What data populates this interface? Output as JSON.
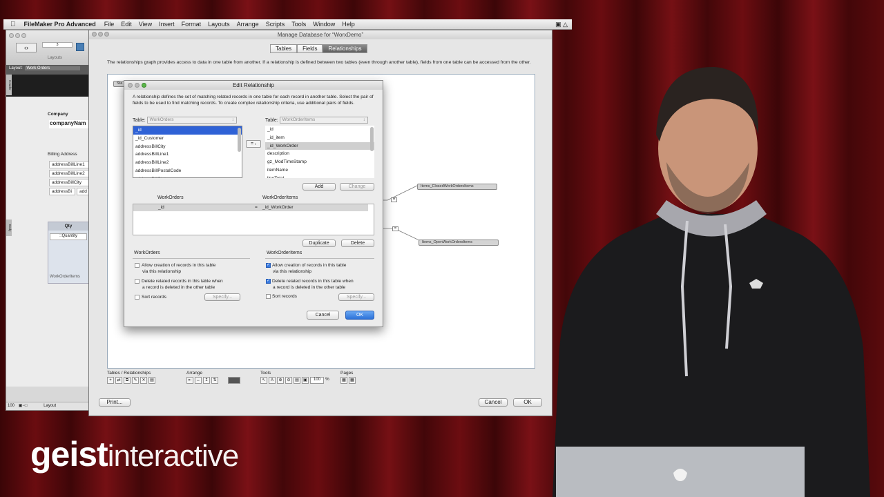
{
  "menubar": {
    "app_name": "FileMaker Pro Advanced",
    "items": [
      "File",
      "Edit",
      "View",
      "Insert",
      "Format",
      "Layouts",
      "Arrange",
      "Scripts",
      "Tools",
      "Window",
      "Help"
    ]
  },
  "fm_window": {
    "record_number": "3",
    "layouts_label": "Layouts",
    "layout_prefix": "Layout:",
    "layout_name": "Work Orders",
    "header_tab": "Header",
    "company_label": "Company",
    "company_field": "companyNam",
    "billing_label": "Billing Address",
    "billing_fields": [
      "addressBillLine1",
      "addressBillLine2",
      "addressBillCity",
      "addressBi"
    ],
    "billing_extra": "add",
    "qty_label": "Qty",
    "qty_field": "::Quantity",
    "portal_label": "WorkOrderItems",
    "body_tab": "Body",
    "zoom": "100",
    "mode": "Layout"
  },
  "manage_db": {
    "title": "Manage Database for “WorxDemo”",
    "tabs": [
      "Tables",
      "Fields",
      "Relationships"
    ],
    "active_tab": "Relationships",
    "description": "The relationships graph provides access to data in one table from another. If a relationship is defined between two tables (even through another table), fields from one table can be accessed from the other.",
    "graph_partial_label": "Sta",
    "occurrences": [
      "Items_ClosedWorkOrdersItems",
      "Items_OpenWorkOrdersItems"
    ],
    "rel_symbol": "=",
    "toolbar_groups": [
      "Tables / Relationships",
      "Arrange",
      "Tools",
      "Pages"
    ],
    "zoom_value": "100",
    "zoom_unit": "%",
    "print_label": "Print...",
    "cancel_label": "Cancel",
    "ok_label": "OK"
  },
  "edit_relationship": {
    "title": "Edit Relationship",
    "description": "A relationship defines the set of matching related records in one table for each record in another table. Select the pair of fields to be used to find matching records. To create complex relationship criteria, use additional pairs of fields.",
    "table_label": "Table:",
    "left_table": "WorkOrders",
    "right_table": "WorkOrderItems",
    "left_fields": [
      "_id",
      "_id_Customer",
      "addressBillCity",
      "addressBillLine1",
      "addressBillLine2",
      "addressBillPostalCode",
      "addressBillState"
    ],
    "left_selected": "_id",
    "operator": "=",
    "right_fields": [
      "_id",
      "_id_item",
      "_id_WorkOrder",
      "description",
      "gz_ModTimeStamp",
      "itemName",
      "lineTotal"
    ],
    "right_selected": "_id_WorkOrder",
    "add_label": "Add",
    "change_label": "Change",
    "pair_header_left": "WorkOrders",
    "pair_header_right": "WorkOrderItems",
    "pair_left": "_id",
    "pair_op": "=",
    "pair_right": "_id_WorkOrder",
    "duplicate_label": "Duplicate",
    "delete_label": "Delete",
    "left_opts_title": "WorkOrders",
    "right_opts_title": "WorkOrderItems",
    "allow_create_line1": "Allow creation of records in this table",
    "allow_create_line2": "via this relationship",
    "delete_related_line1": "Delete related records in this table when",
    "delete_related_line2": "a record is deleted in the other table",
    "sort_records": "Sort records",
    "specify_label": "Specify...",
    "left_allow_create": false,
    "left_delete_related": false,
    "left_sort": false,
    "right_allow_create": true,
    "right_delete_related": true,
    "right_sort": false,
    "cancel_label": "Cancel",
    "ok_label": "OK"
  },
  "logo": {
    "bold": "geist",
    "light": "interactive"
  },
  "colors": {
    "selection": "#2f62d6",
    "default_button": "#2d72d8",
    "curtain": "#6a0c10"
  }
}
